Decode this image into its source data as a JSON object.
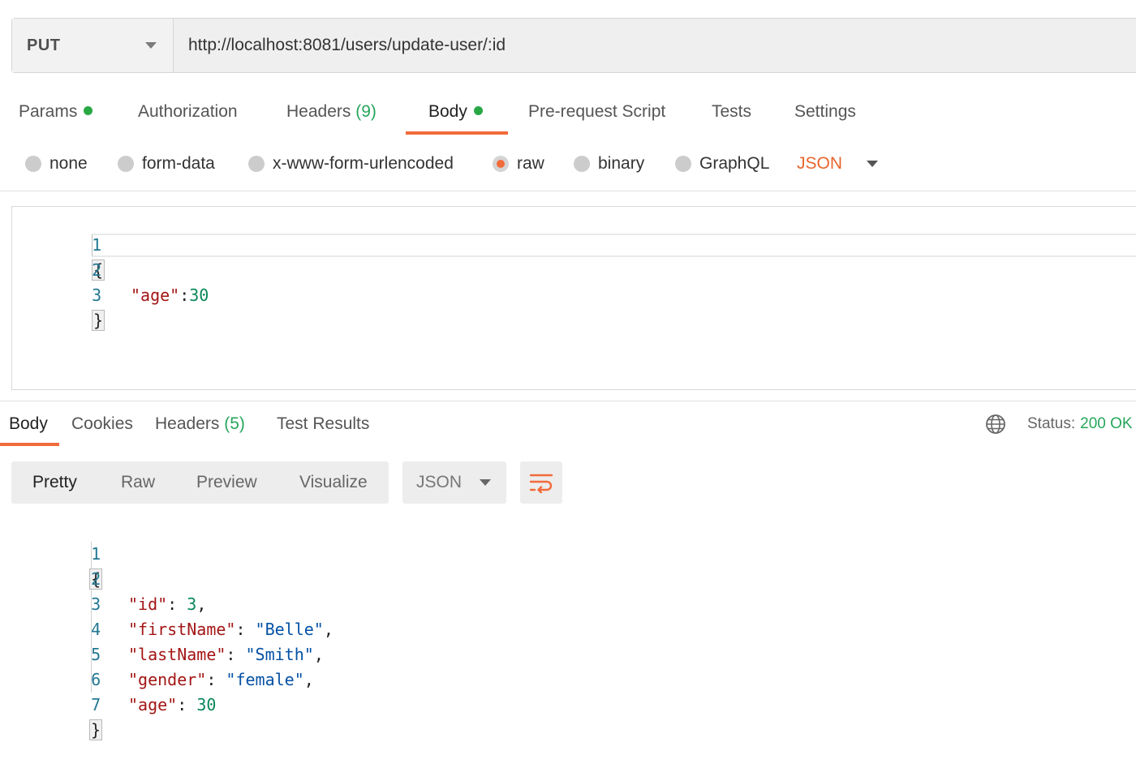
{
  "request": {
    "method": "PUT",
    "url": "http://localhost:8081/users/update-user/:id"
  },
  "request_tabs": [
    {
      "label": "Params",
      "dot": true
    },
    {
      "label": "Authorization"
    },
    {
      "label": "Headers",
      "count": "(9)"
    },
    {
      "label": "Body",
      "dot": true,
      "active": true
    },
    {
      "label": "Pre-request Script"
    },
    {
      "label": "Tests"
    },
    {
      "label": "Settings"
    }
  ],
  "body_types": [
    "none",
    "form-data",
    "x-www-form-urlencoded",
    "raw",
    "binary",
    "GraphQL"
  ],
  "body_type_selected": "raw",
  "body_format": "JSON",
  "request_body": {
    "line_numbers": [
      "1",
      "2",
      "3"
    ],
    "open": "{",
    "key": "\"age\"",
    "colon": ":",
    "value": "30",
    "close": "}"
  },
  "response_tabs": [
    {
      "label": "Body",
      "active": true
    },
    {
      "label": "Cookies"
    },
    {
      "label": "Headers",
      "count": "(5)"
    },
    {
      "label": "Test Results"
    }
  ],
  "status": {
    "label": "Status:",
    "value": "200 OK"
  },
  "view_modes": [
    "Pretty",
    "Raw",
    "Preview",
    "Visualize"
  ],
  "view_mode_selected": "Pretty",
  "response_format": "JSON",
  "response_body": {
    "line_numbers": [
      "1",
      "2",
      "3",
      "4",
      "5",
      "6",
      "7"
    ],
    "open": "{",
    "close": "}",
    "fields": [
      {
        "key": "\"id\"",
        "value": "3",
        "sep": ","
      },
      {
        "key": "\"firstName\"",
        "value": "\"Belle\"",
        "sep": ","
      },
      {
        "key": "\"lastName\"",
        "value": "\"Smith\"",
        "sep": ","
      },
      {
        "key": "\"gender\"",
        "value": "\"female\"",
        "sep": ","
      },
      {
        "key": "\"age\"",
        "value": "30",
        "sep": ""
      }
    ]
  },
  "colors": {
    "accent": "#f26b3a",
    "success": "#26a65b",
    "key": "#a31515",
    "number": "#09885a",
    "string": "#0451a5"
  },
  "icons": {
    "method_dropdown": "chevron-down-icon",
    "globe": "globe-icon",
    "wrap": "wrap-lines-icon"
  }
}
